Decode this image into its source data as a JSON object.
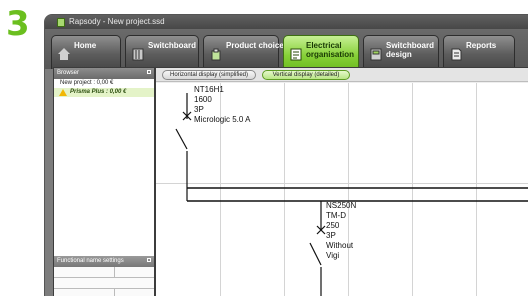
{
  "step_number": "3",
  "window": {
    "title": "Rapsody - New project.ssd"
  },
  "tabs": [
    {
      "label": "Home",
      "icon": "home-icon",
      "active": false
    },
    {
      "label": "Switchboard",
      "icon": "switchboard-icon",
      "active": false
    },
    {
      "label": "Product choice",
      "icon": "product-choice-icon",
      "active": false
    },
    {
      "label": "Electrical organisation",
      "icon": "electrical-organisation-icon",
      "active": true
    },
    {
      "label": "Switchboard design",
      "icon": "switchboard-design-icon",
      "active": false
    },
    {
      "label": "Reports",
      "icon": "reports-icon",
      "active": false
    }
  ],
  "browser": {
    "header": "Browser",
    "items": [
      {
        "label": "New project : 0,00 €",
        "selected": false
      },
      {
        "label": "Prisma Plus : 0,00 €",
        "selected": true,
        "icon": "warning-icon"
      }
    ]
  },
  "functional_panel": {
    "header": "Functional name settings"
  },
  "view_buttons": [
    {
      "label": "Horizontal display (simplified)",
      "active": false
    },
    {
      "label": "Vertical display (detailed)",
      "active": true
    }
  ],
  "breakers": [
    {
      "name": "NT16H1",
      "lines": [
        "1600",
        "3P",
        "Micrologic 5.0 A"
      ]
    },
    {
      "name": "NS250N",
      "lines": [
        "TM-D",
        "250",
        "3P",
        "Without",
        "Vigi"
      ]
    }
  ],
  "colors": {
    "accent_green": "#6bbf1f",
    "active_tab": "#86d037",
    "window_bg": "#7d7d7d"
  }
}
